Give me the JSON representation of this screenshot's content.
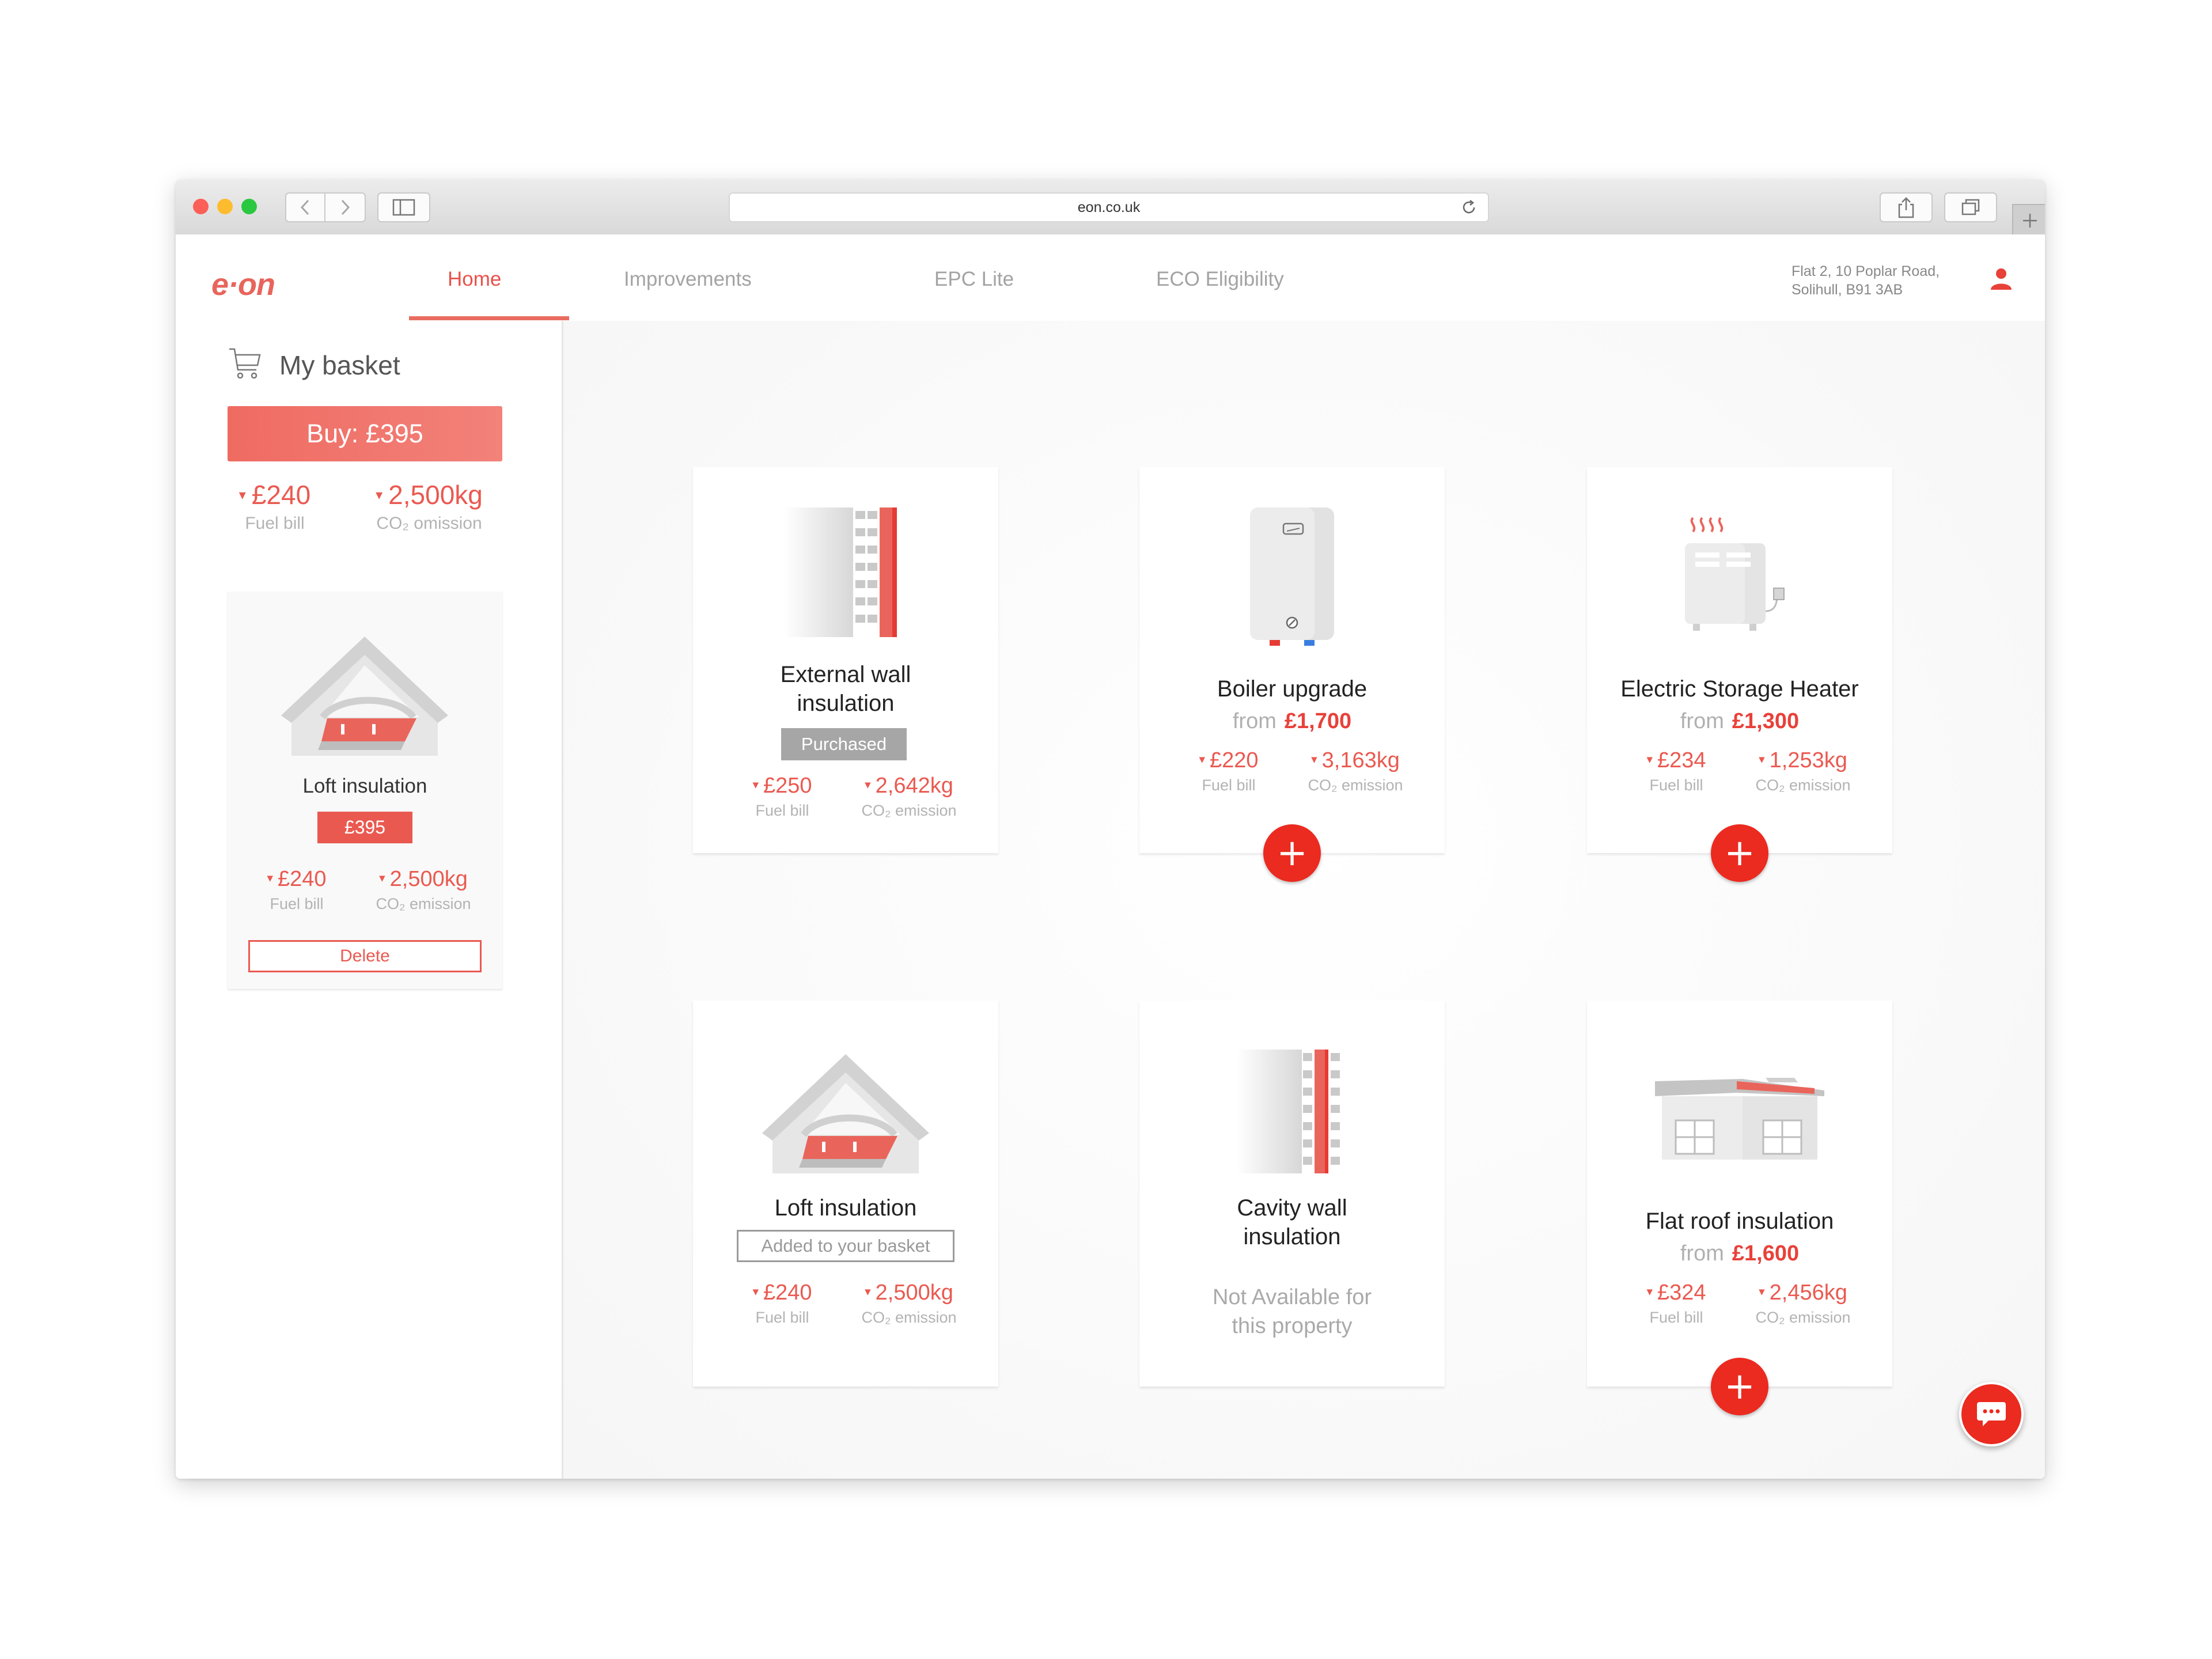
{
  "browser": {
    "url": "eon.co.uk"
  },
  "header": {
    "logo": "e·on",
    "tabs": [
      {
        "label": "Home",
        "active": true
      },
      {
        "label": "Improvements",
        "active": false
      },
      {
        "label": "EPC Lite",
        "active": false
      },
      {
        "label": "ECO Eligibility",
        "active": false
      }
    ],
    "address_line1": "Flat 2, 10 Poplar Road,",
    "address_line2": "Solihull, B91 3AB"
  },
  "basket": {
    "title": "My basket",
    "buy_label": "Buy:  £395",
    "fuel_value": "£240",
    "fuel_label": "Fuel bill",
    "co2_value": "2,500kg",
    "co2_label": "CO₂ omission",
    "item": {
      "title": "Loft insulation",
      "price": "£395",
      "fuel_value": "£240",
      "fuel_label": "Fuel bill",
      "co2_value": "2,500kg",
      "co2_label": "CO₂ emission",
      "delete_label": "Delete"
    }
  },
  "cards": [
    {
      "title_line1": "External wall",
      "title_line2": "insulation",
      "status": "Purchased",
      "fuel_value": "£250",
      "fuel_label": "Fuel bill",
      "co2_value": "2,642kg",
      "co2_label": "CO₂ emission"
    },
    {
      "title": "Boiler upgrade",
      "from_label": "from",
      "price": "£1,700",
      "fuel_value": "£220",
      "fuel_label": "Fuel bill",
      "co2_value": "3,163kg",
      "co2_label": "CO₂ emission",
      "add_label": "+"
    },
    {
      "title": "Electric Storage Heater",
      "from_label": "from",
      "price": "£1,300",
      "fuel_value": "£234",
      "fuel_label": "Fuel bill",
      "co2_value": "1,253kg",
      "co2_label": "CO₂ emission",
      "add_label": "+"
    },
    {
      "title": "Loft insulation",
      "status": "Added to your basket",
      "fuel_value": "£240",
      "fuel_label": "Fuel bill",
      "co2_value": "2,500kg",
      "co2_label": "CO₂ emission"
    },
    {
      "title_line1": "Cavity wall",
      "title_line2": "insulation",
      "na_line1": "Not Available for",
      "na_line2": "this property"
    },
    {
      "title": "Flat roof insulation",
      "from_label": "from",
      "price": "£1,600",
      "fuel_value": "£324",
      "fuel_label": "Fuel bill",
      "co2_value": "2,456kg",
      "co2_label": "CO₂ emission",
      "add_label": "+"
    }
  ],
  "colors": {
    "brand": "#ea5950",
    "accent": "#eb2a20",
    "muted": "#b0b0b0"
  },
  "icons": {
    "cart": "shopping-cart-icon",
    "user": "user-icon",
    "chat": "chat-bubble-icon",
    "triangle": "▾"
  }
}
